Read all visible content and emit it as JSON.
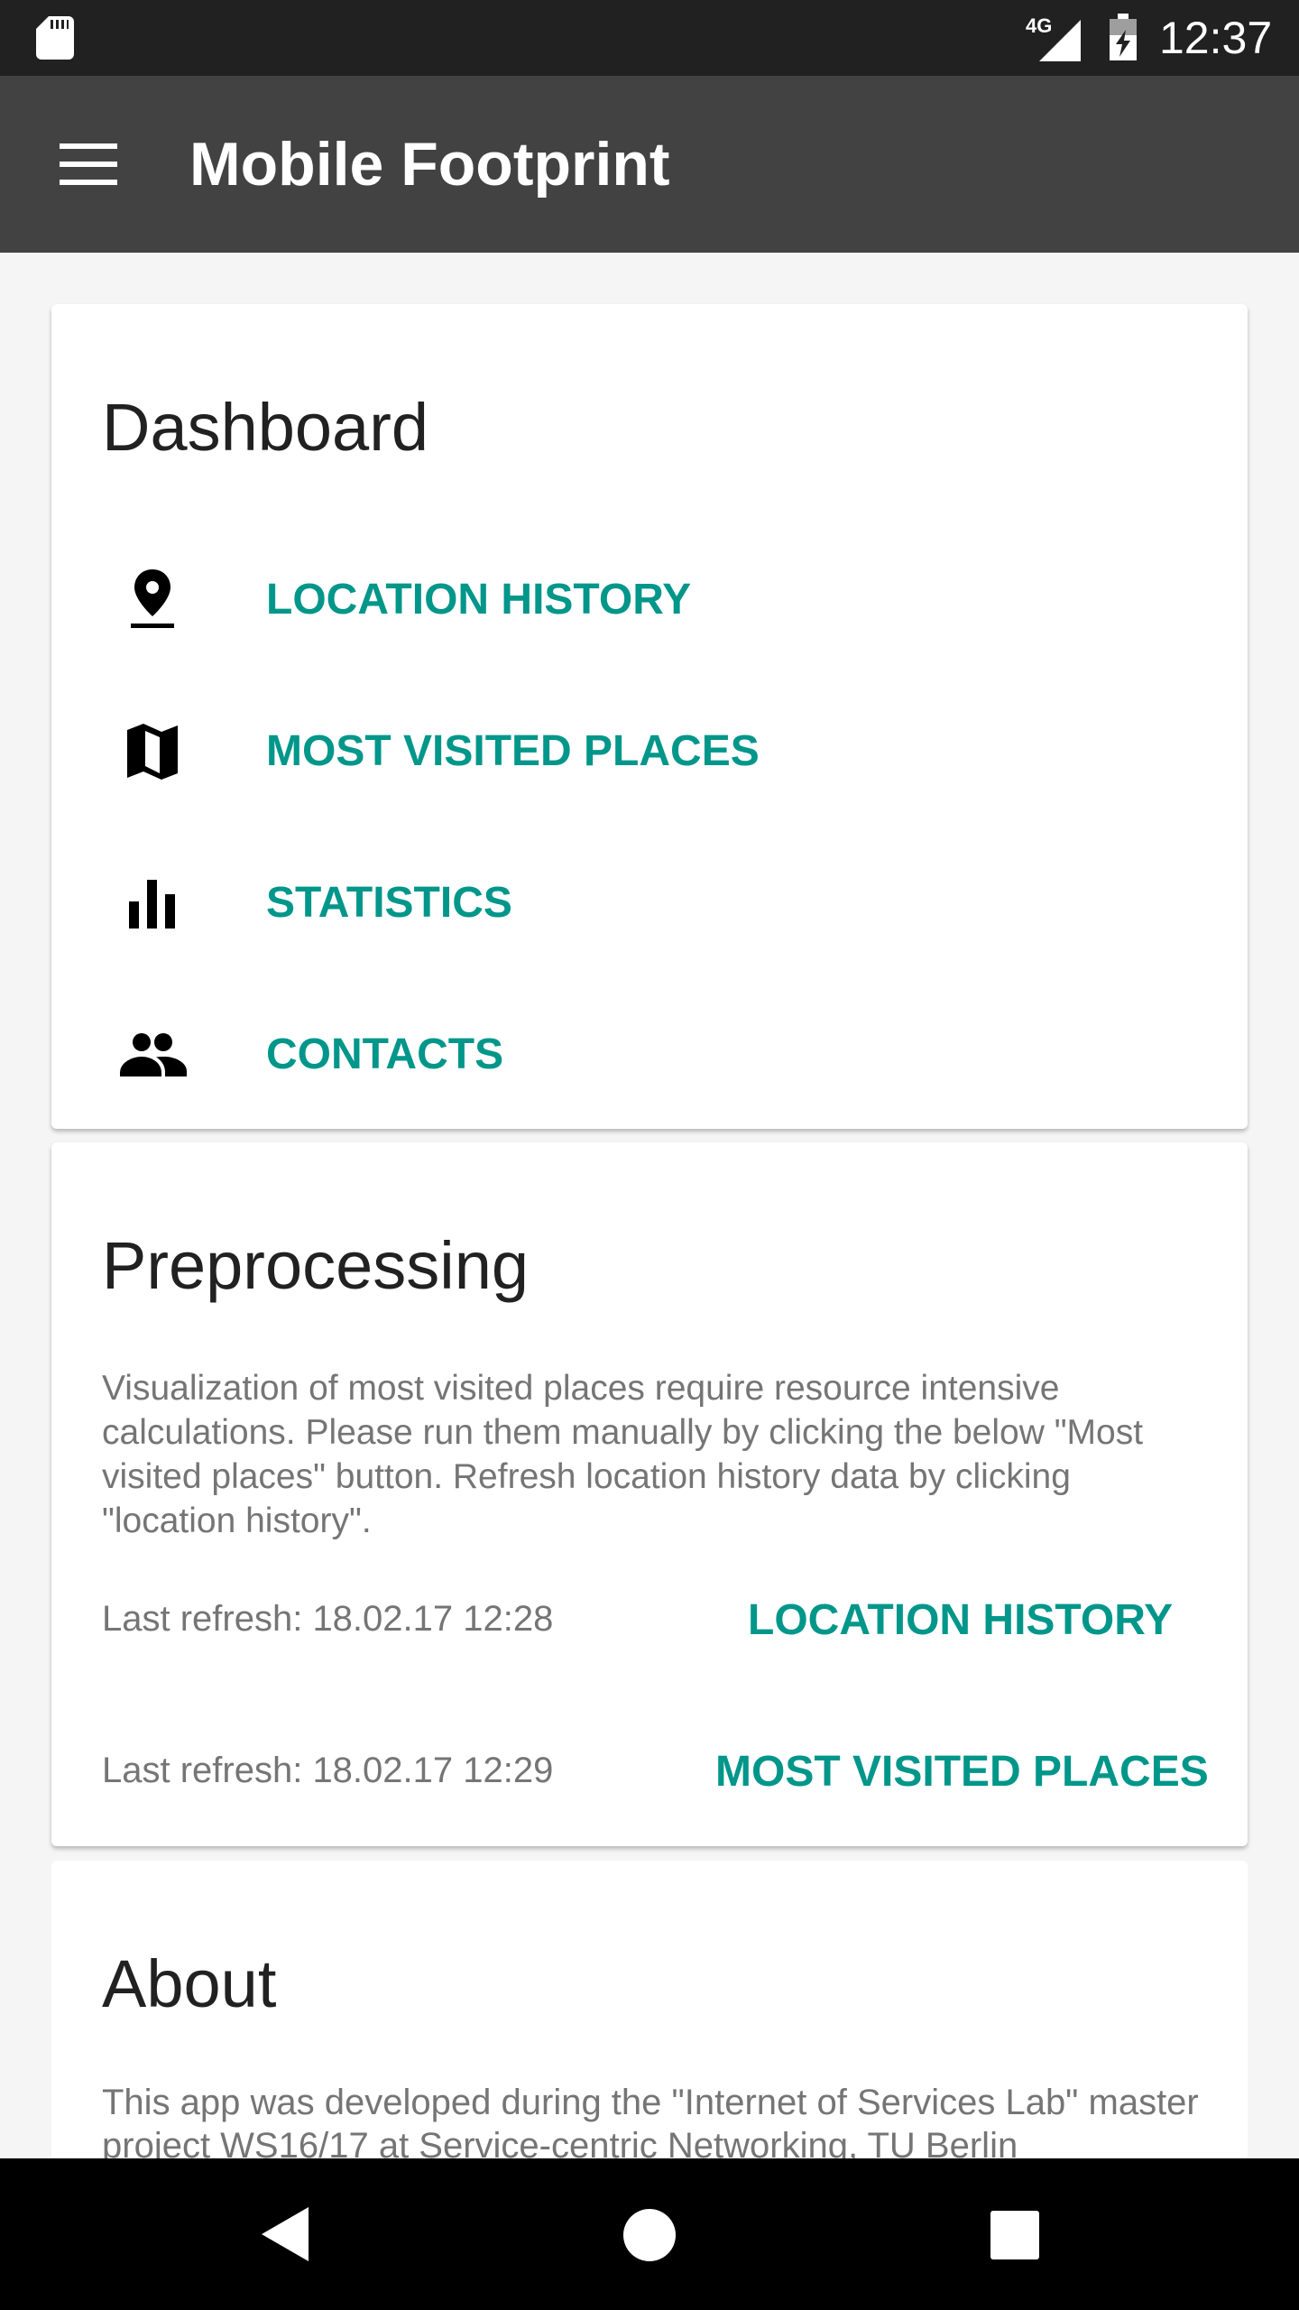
{
  "status_bar": {
    "network": "4G",
    "time": "12:37"
  },
  "app_bar": {
    "title": "Mobile Footprint"
  },
  "dashboard": {
    "title": "Dashboard",
    "items": [
      {
        "label": "LOCATION HISTORY",
        "icon": "location-pin-icon"
      },
      {
        "label": "MOST VISITED PLACES",
        "icon": "map-icon"
      },
      {
        "label": "STATISTICS",
        "icon": "bar-chart-icon"
      },
      {
        "label": "CONTACTS",
        "icon": "people-icon"
      }
    ]
  },
  "preprocessing": {
    "title": "Preprocessing",
    "description": "Visualization of most visited places require resource intensive calculations. Please run them manually by clicking the below \"Most visited places\" button. Refresh location history data by clicking \"location history\".",
    "rows": [
      {
        "refresh_text": "Last refresh:  18.02.17 12:28",
        "button": "LOCATION HISTORY"
      },
      {
        "refresh_text": "Last refresh:  18.02.17 12:29",
        "button": "MOST VISITED PLACES"
      }
    ]
  },
  "about": {
    "title": "About",
    "text": "This app was developed during the \"Internet of Services Lab\" master project WS16/17 at Service-centric Networking, TU Berlin"
  },
  "colors": {
    "accent": "#00968a",
    "status_bar": "#212121",
    "app_bar": "#424242",
    "background": "#f5f5f5"
  }
}
